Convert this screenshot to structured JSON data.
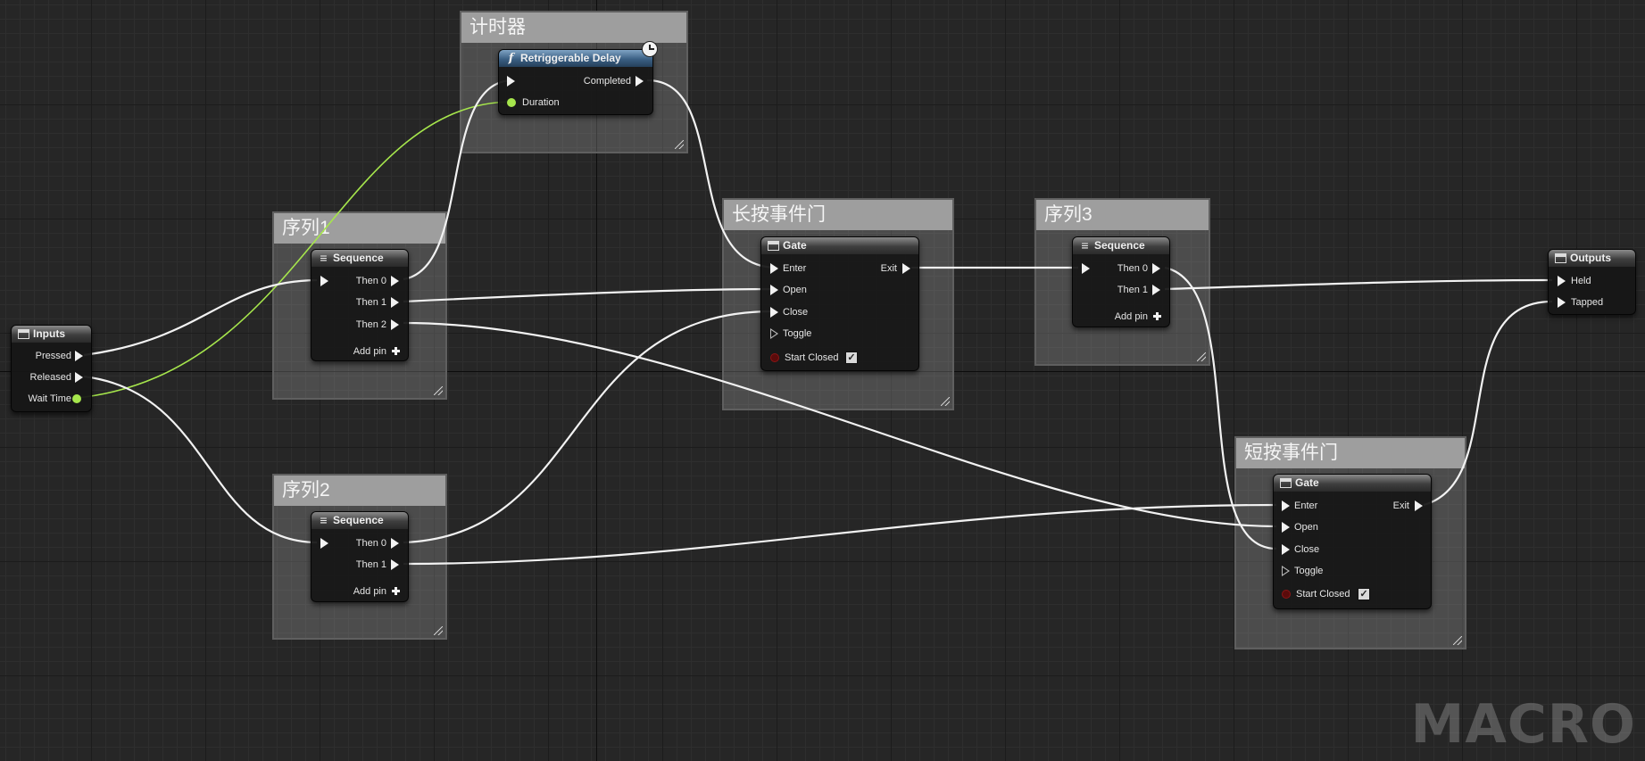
{
  "graph_type_label": "MACRO",
  "colors": {
    "exec_wire": "#f2f2f2",
    "float_wire": "#a6e64c",
    "function_header": "#3a5f83",
    "comment_title": "#9e9e9e",
    "background": "#262626"
  },
  "comments": {
    "timer": "计时器",
    "seq1": "序列1",
    "seq2": "序列2",
    "seq3": "序列3",
    "long_gate": "长按事件门",
    "short_gate": "短按事件门"
  },
  "nodes": {
    "inputs": {
      "title": "Inputs",
      "icon": "tunnel-icon",
      "pins": [
        "Pressed",
        "Released",
        "Wait Time"
      ]
    },
    "outputs": {
      "title": "Outputs",
      "icon": "tunnel-icon",
      "pins": [
        "Held",
        "Tapped"
      ]
    },
    "delay": {
      "title": "Retriggerable Delay",
      "icon": "function-icon",
      "latent_icon": "clock-icon",
      "input_pin": "Duration",
      "output_pin": "Completed"
    },
    "seq1": {
      "title": "Sequence",
      "icon": "sequence-icon",
      "outputs": [
        "Then 0",
        "Then 1",
        "Then 2"
      ],
      "add_pin": "Add pin"
    },
    "seq2": {
      "title": "Sequence",
      "icon": "sequence-icon",
      "outputs": [
        "Then 0",
        "Then 1"
      ],
      "add_pin": "Add pin"
    },
    "seq3": {
      "title": "Sequence",
      "icon": "sequence-icon",
      "outputs": [
        "Then 0",
        "Then 1"
      ],
      "add_pin": "Add pin"
    },
    "long_gate": {
      "title": "Gate",
      "icon": "gate-icon",
      "inputs": [
        "Enter",
        "Open",
        "Close",
        "Toggle",
        "Start Closed"
      ],
      "output": "Exit",
      "start_closed_checked": true
    },
    "short_gate": {
      "title": "Gate",
      "icon": "gate-icon",
      "inputs": [
        "Enter",
        "Open",
        "Close",
        "Toggle",
        "Start Closed"
      ],
      "output": "Exit",
      "start_closed_checked": true
    }
  }
}
